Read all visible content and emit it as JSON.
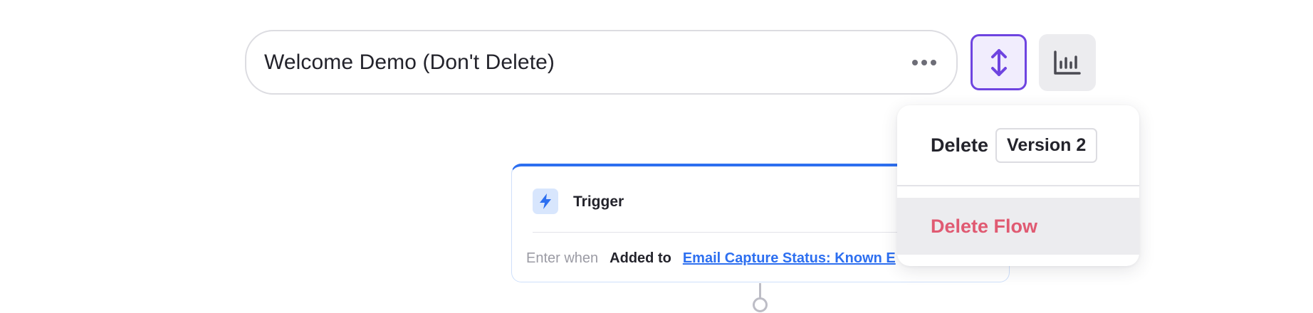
{
  "header": {
    "flow_name": "Welcome Demo (Don't Delete)",
    "more_icon": "more-horizontal-icon",
    "sort_icon": "vertical-arrows-icon",
    "stats_icon": "bar-chart-icon"
  },
  "trigger": {
    "title": "Trigger",
    "icon": "lightning-bolt-icon",
    "enter_when_label": "Enter when",
    "added_to_label": "Added to",
    "list_link": "Email Capture Status: Known E"
  },
  "menu": {
    "delete_label": "Delete",
    "version_badge": "Version 2",
    "delete_flow_label": "Delete Flow"
  },
  "colors": {
    "accent_purple": "#6e44e0",
    "accent_blue": "#2d6ff0",
    "danger": "#e05a72"
  }
}
